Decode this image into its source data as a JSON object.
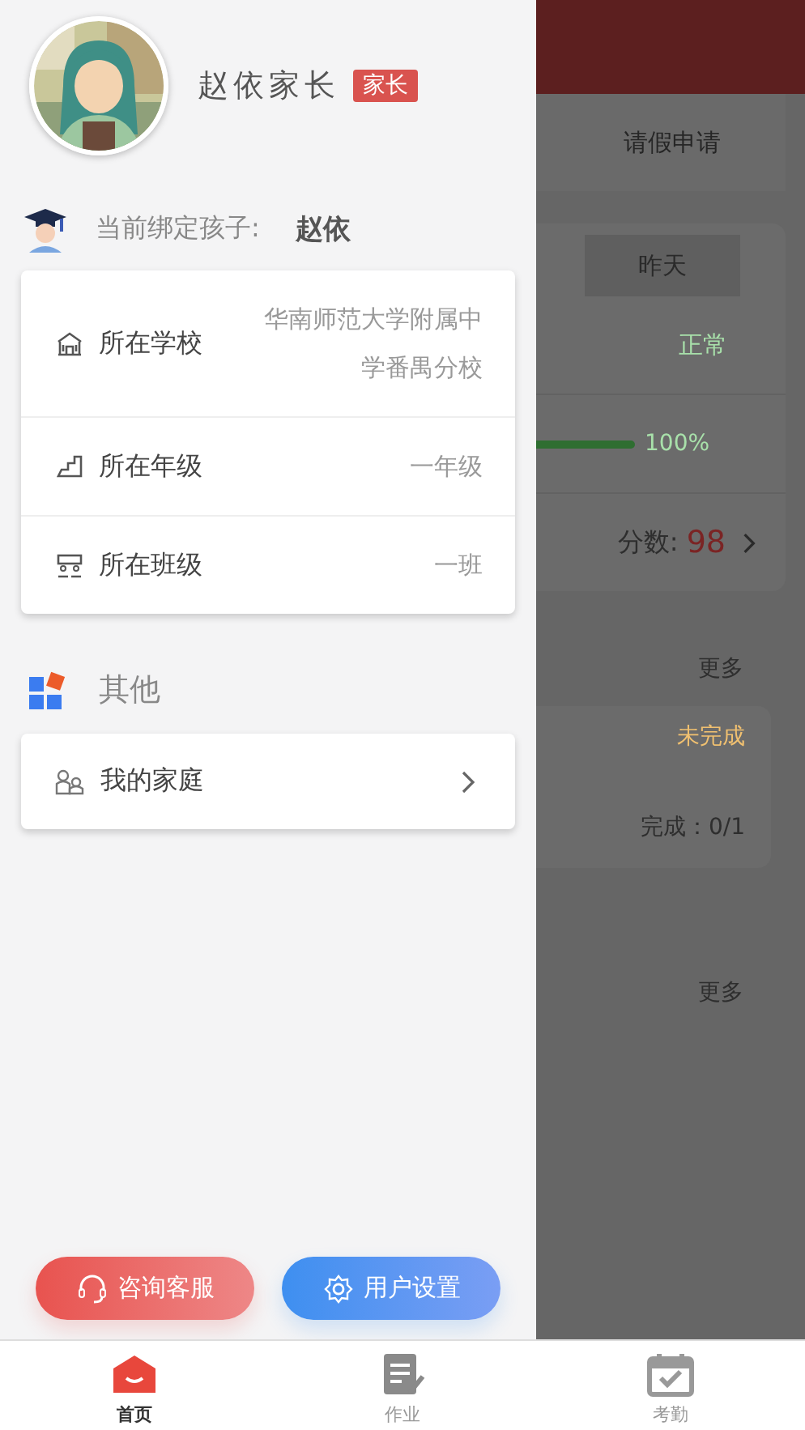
{
  "drawer": {
    "user": {
      "name": "赵依家长",
      "role_badge": "家长"
    },
    "child_binding": {
      "label": "当前绑定孩子:",
      "name": "赵依"
    },
    "info_rows": [
      {
        "kind": "school",
        "label": "所在学校",
        "value": "华南师范大学附属中学番禺分校"
      },
      {
        "kind": "grade",
        "label": "所在年级",
        "value": "一年级"
      },
      {
        "kind": "class",
        "label": "所在班级",
        "value": "一班"
      }
    ],
    "other_section": {
      "title": "其他",
      "items": [
        {
          "label": "我的家庭"
        }
      ]
    },
    "buttons": [
      {
        "kind": "support",
        "label": "咨询客服"
      },
      {
        "kind": "settings",
        "label": "用户设置"
      }
    ]
  },
  "background_page": {
    "tab": "请假申请",
    "day_tab": "昨天",
    "status": "正常",
    "progress": {
      "reading": "100%"
    },
    "score": {
      "label": "分数:",
      "value": "98"
    },
    "more_links": [
      "更多",
      "更多"
    ],
    "task": {
      "status": "未完成",
      "progress": "完成：0/1"
    }
  },
  "bottom_nav": [
    {
      "kind": "home",
      "label": "首页",
      "selected": true
    },
    {
      "kind": "homework",
      "label": "作业",
      "selected": false
    },
    {
      "kind": "attendance",
      "label": "考勤",
      "selected": false
    }
  ]
}
